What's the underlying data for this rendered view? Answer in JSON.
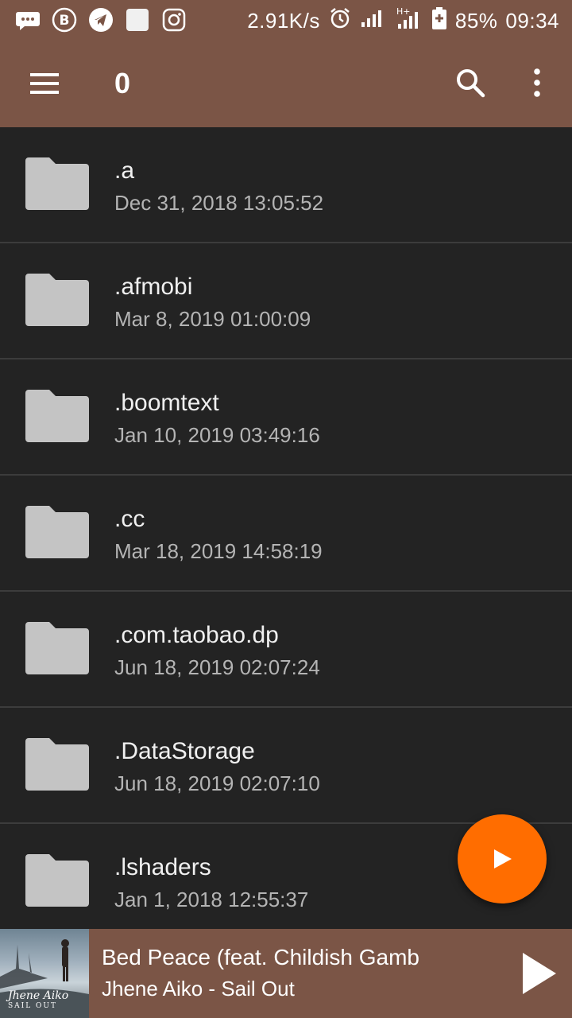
{
  "status_bar": {
    "network_speed": "2.91K/s",
    "battery": "85%",
    "time": "09:34",
    "icons": [
      "message-icon",
      "b-app-icon",
      "telegram-icon",
      "square-app-icon",
      "instagram-icon",
      "alarm-icon",
      "signal-icon",
      "signal-h-plus-icon",
      "battery-icon"
    ]
  },
  "app_bar": {
    "title": "0",
    "icons": [
      "menu-icon",
      "search-icon",
      "more-vert-icon"
    ]
  },
  "files": [
    {
      "name": ".a",
      "date": "Dec 31, 2018 13:05:52"
    },
    {
      "name": ".afmobi",
      "date": "Mar 8, 2019 01:00:09"
    },
    {
      "name": ".boomtext",
      "date": "Jan 10, 2019 03:49:16"
    },
    {
      "name": ".cc",
      "date": "Mar 18, 2019 14:58:19"
    },
    {
      "name": ".com.taobao.dp",
      "date": "Jun 18, 2019 02:07:24"
    },
    {
      "name": ".DataStorage",
      "date": "Jun 18, 2019 02:07:10"
    },
    {
      "name": ".lshaders",
      "date": "Jan 1, 2018 12:55:37"
    }
  ],
  "player": {
    "track_title": "Bed Peace (feat. Childish Gamb",
    "track_artist": "Jhene Aiko - Sail Out",
    "album_art_text": "Jhene Aiko",
    "album_art_subtext": "SAIL OUT"
  },
  "colors": {
    "appbar": "#7b5546",
    "background": "#232323",
    "fab": "#ff6d00",
    "folder": "#c4c4c4"
  }
}
